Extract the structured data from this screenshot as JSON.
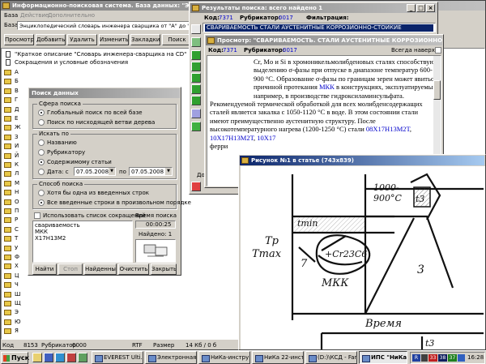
{
  "main": {
    "title": "Информационно-поисковая система. База данных: \"Энциклопедический словарь инженера-сварщика от \"А\" до \"Я\"\"",
    "menu": [
      "База",
      "Действие",
      "Дополнительно"
    ],
    "base_label": "База",
    "base_value": "Энциклопедический словарь инженера сварщика от \"А\" до \"Я\"",
    "toolbar": [
      "Просмотр",
      "Добавить",
      "Удалить",
      "Изменить",
      "Закладки",
      "Поиск"
    ],
    "tree_top": [
      "\"Краткое описание \"Словарь инженера-сварщика на CD\"",
      "Сокращения и условные обозначения"
    ],
    "tree_letters": [
      "А",
      "Б",
      "В",
      "Г",
      "Д",
      "Е",
      "Ж",
      "З",
      "И",
      "Й",
      "К",
      "Л",
      "М",
      "Н",
      "О",
      "П",
      "Р",
      "С",
      "Т",
      "У",
      "Ф",
      "Х",
      "Ц",
      "Ч",
      "Ш",
      "Щ",
      "Э",
      "Ю",
      "Я"
    ],
    "status": {
      "code_label": "Код",
      "code": "8153",
      "rub_label": "Рубрикатор",
      "rub": "0000",
      "format": "RTF",
      "size_label": "Размер",
      "size": "14 Кб / 0 б"
    }
  },
  "search_dialog": {
    "title": "Поиск данных",
    "sphere_title": "Сфера поиска",
    "sphere": [
      "Глобальный поиск по всей базе",
      "Поиск по нисходящей ветви дерева"
    ],
    "search_in_title": "Искать по",
    "search_in": [
      "Названию",
      "Рубрикатору",
      "Содержимому статьи",
      "Дата:  с"
    ],
    "date_from": "07.05.2008",
    "date_to_label": "по",
    "date_to": "07.05.2008",
    "method_title": "Способ поиска",
    "method": [
      "Хотя бы одна из введенных строк",
      "Все введенные строки в произвольном порядке"
    ],
    "abbrev_label": "Использовать список сокращений",
    "query_lines": [
      "свариваемость",
      "МКК",
      "Х17Н13М2"
    ],
    "time_label": "Время поиска",
    "time": "00:00:25",
    "found_label": "Найдено: 1",
    "buttons": [
      "Найти",
      "Стоп",
      "Найденные",
      "Очистить",
      "Закрыть"
    ]
  },
  "results": {
    "title": "Результаты поиска: всего найдено 1",
    "code_label": "Код:",
    "code": "7371",
    "rub_label": "Рубрикатор:",
    "rub": "0017",
    "filter_label": "Фильтрация:",
    "item": "СВАРИВАЕМОСТЬ СТАЛИ АУСТЕНИТНЫЕ КОРРОЗИОННО-СТОЙКИЕ",
    "bottom_label": "Допол"
  },
  "viewer": {
    "title": "Просмотр: \"СВАРИВАЕМОСТЬ. СТАЛИ АУСТЕНИТНЫЕ КОРРОЗИОННО",
    "code_label": "Код:",
    "code": "7371",
    "rub_label": "Рубрикатор:",
    "rub": "0017",
    "top_label": "Всегда наверху",
    "p1": "Cr, Mo и Si в хромоникельмолибденовых сталях способствуют выделению σ-фазы при отпуске в диапазоне температур 600-900 °С. Образование σ-фазы по границам зерен может явиться причиной протекания",
    "p1_link": "МКК",
    "p1_end": "в конструкциях, эксплуатируемых, например, в производстве гидроксиламинсульфата.",
    "p2": "Рекомендуемой термической обработкой для всех молибденсодержащих сталей является закалка с 1050-1120 °С в воде. В этом состоянии стали имеют преимущественно аустенитную структуру. После высокотемпературного нагрева (1200-1250 °С) стали",
    "p2_l1": "08Х17Н13М2Т",
    "p2_l2": "10Х17Н13М2Т",
    "p2_l3": "10Х17",
    "p3": "ферри"
  },
  "figure": {
    "title": "Рисунок №1 в статье (743x839)",
    "labels": {
      "temp": "1000-\n900°С",
      "t3": "t3",
      "tmin": "tmin",
      "tp": "Tр",
      "tmax": "Tmax",
      "seven": "7",
      "carbide": "+Cr23C6",
      "mkk": "МКК",
      "three": "3",
      "time": "Время",
      "t3b": "t3"
    }
  },
  "taskbar": {
    "start": "Пуск",
    "tasks": [
      "EVEREST Ulti...",
      "Электронная...",
      "НиКа-инстру...",
      "НиКа 22-инст...",
      "(D:)\\КСД - Far",
      "ИПС \"НиКа\""
    ],
    "tray_nums": [
      "33",
      "38",
      "37"
    ],
    "clock": "16:28"
  },
  "colors": {
    "title_active": "#0a246a",
    "title_inactive": "#808080",
    "link": "#0000cc",
    "selection": "#0a246a",
    "taskbar": "#d4d0c8"
  }
}
